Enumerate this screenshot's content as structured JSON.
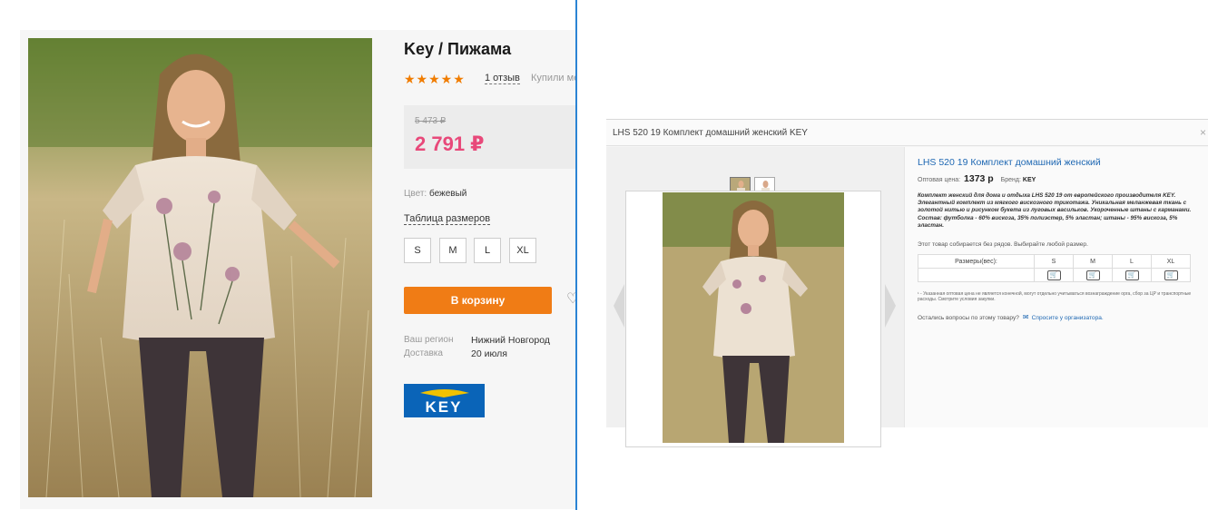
{
  "product": {
    "title": "Key / Пижама",
    "rating_stars": "★★★★★",
    "reviews_link": "1 отзыв",
    "bought_text": "Купили ме",
    "old_price": "5 473 ₽",
    "price": "2 791 ₽",
    "color_label": "Цвет:",
    "color_value": "бежевый",
    "size_table_link": "Таблица размеров",
    "sizes": [
      "S",
      "M",
      "L",
      "XL"
    ],
    "add_to_cart": "В корзину",
    "heart_icon": "♡",
    "region_label": "Ваш регион",
    "region_value": "Нижний Новгород",
    "delivery_label": "Доставка",
    "delivery_value": "20 июля",
    "brand_logo_name": "key-brand-logo",
    "logo_wordmark": "KEY"
  },
  "modal": {
    "title": "LHS 520 19 Комплект домашний женский KEY",
    "close_icon": "×",
    "product_link": "LHS 520 19 Комплект домашний женский",
    "wholesale_label": "Оптовая цена:",
    "wholesale_price": "1373 р",
    "brand_label": "Бренд:",
    "brand_value": "KEY",
    "description": "Комплект женский для дома и отдыха LHS 520 19 от европейского производителя KEY. Элегантный комплект из мягкого вискозного трикотажа. Уникальная меланжевая ткань с золотой нитью и рисунком букета из луговых васильков. Укороченные штаны с карманами. Состав: футболка - 60% вискоза, 35% полиэстер, 5% эластан; штаны - 95% вискоза, 5% эластан.",
    "collect_note": "Этот товар собирается без рядов. Выбирайте любой размер.",
    "size_header": "Размеры(вес):",
    "sizes": [
      "S",
      "M",
      "L",
      "XL"
    ],
    "cart_icon": "🛒",
    "footnote": "¹ - Указанная оптовая цена не является конечной, могут отдельно учитываться вознаграждение орга, сбор за ЦР и транспортные расходы. Смотрите условия закупки.",
    "question_text": "Остались вопросы по этому товару?",
    "ask_link": "Спросите у организатора.",
    "mail_icon": "✉"
  },
  "colors": {
    "accent_orange": "#f07c15",
    "price_pink": "#e8497a",
    "link_blue": "#1f68b3",
    "brand_blue": "#0a64b8"
  }
}
